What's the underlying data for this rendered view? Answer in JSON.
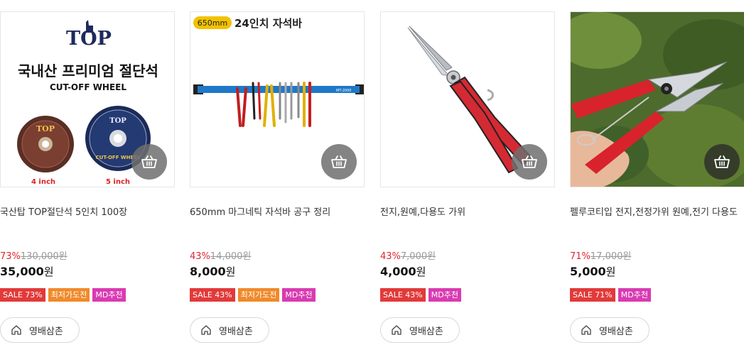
{
  "products": [
    {
      "title": "국산탑 TOP절단석 5인치 100장",
      "discount": "73%",
      "original_price": "130,000원",
      "price": "35,000",
      "currency": "원",
      "badges": [
        {
          "text": "SALE 73%",
          "kind": "sale"
        },
        {
          "text": "최저가도전",
          "kind": "low"
        },
        {
          "text": "MD추천",
          "kind": "md"
        }
      ],
      "store": "영배삼촌",
      "image": {
        "brand": "TOP",
        "headline": "국내산 프리미엄 절단석",
        "subline": "CUT-OFF WHEEL",
        "disc_left_label": "4 inch",
        "disc_right_label": "5 inch",
        "disc_brand": "TOP",
        "disc_text": "CUT-OFF WHEEL"
      }
    },
    {
      "title": "650mm 마그네틱 자석바 공구 정리",
      "discount": "43%",
      "original_price": "14,000원",
      "price": "8,000",
      "currency": "원",
      "badges": [
        {
          "text": "SALE 43%",
          "kind": "sale"
        },
        {
          "text": "최저가도전",
          "kind": "low"
        },
        {
          "text": "MD추천",
          "kind": "md"
        }
      ],
      "store": "영배삼촌",
      "image": {
        "size_tag": "650mm",
        "headline": "24인치 자석바"
      }
    },
    {
      "title": "전지,원예,다용도 가위",
      "discount": "43%",
      "original_price": "7,000원",
      "price": "4,000",
      "currency": "원",
      "badges": [
        {
          "text": "SALE 43%",
          "kind": "sale"
        },
        {
          "text": "MD추천",
          "kind": "md"
        }
      ],
      "store": "영배삼촌",
      "image": {}
    },
    {
      "title": "펠루코티입 전지,전정가위 원예,전기 다용도",
      "discount": "71%",
      "original_price": "17,000원",
      "price": "5,000",
      "currency": "원",
      "badges": [
        {
          "text": "SALE 71%",
          "kind": "sale"
        },
        {
          "text": "MD추천",
          "kind": "md"
        }
      ],
      "store": "영배삼촌",
      "image": {}
    }
  ],
  "colors": {
    "discount": "#e0262f",
    "sale_badge": "#e23a3a",
    "lowest_badge": "#f08a2a",
    "md_badge": "#d93bb2"
  }
}
